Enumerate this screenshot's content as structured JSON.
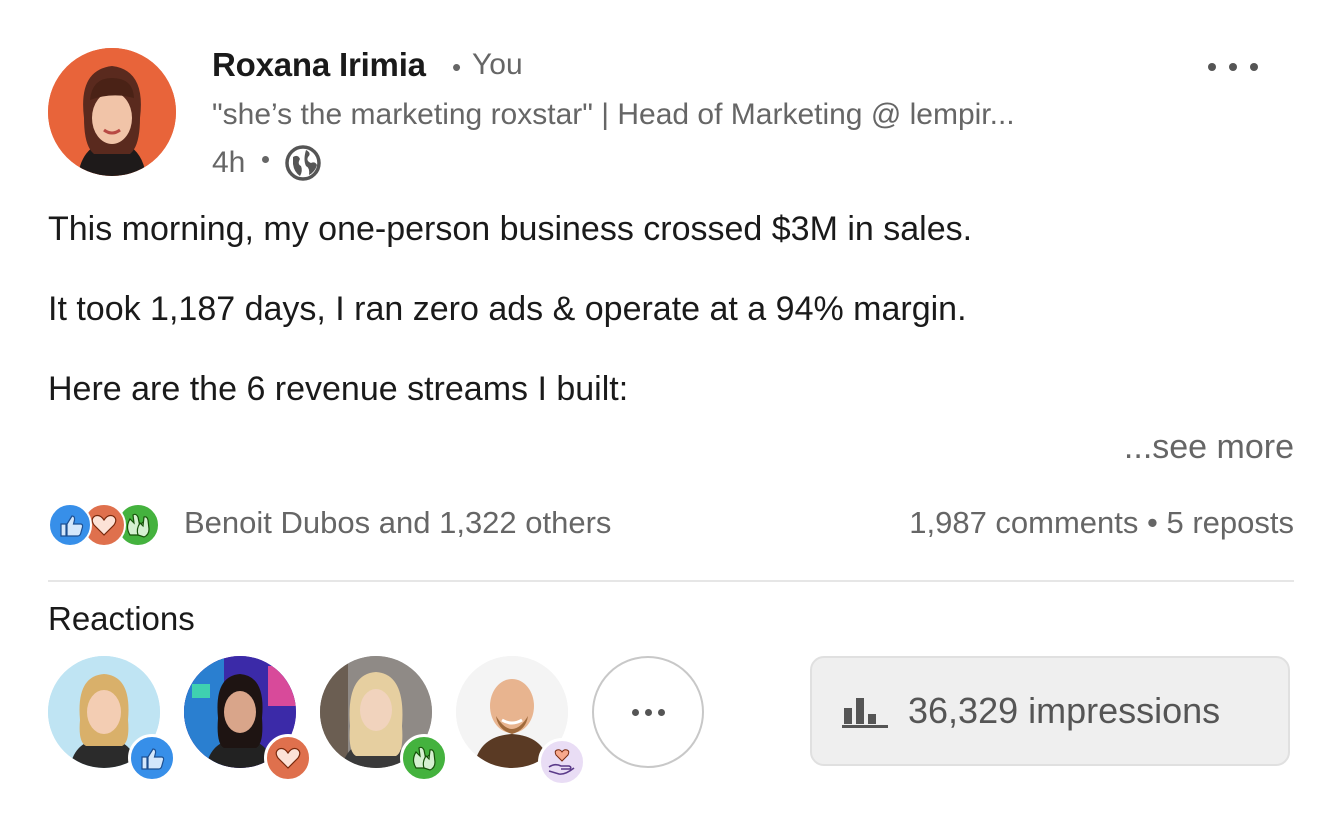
{
  "post": {
    "author_name": "Roxana Irimia",
    "separator": "•",
    "relation": "You",
    "headline": "\"she’s the marketing roxstar\" | Head of Marketing @ lempir...",
    "time": "4h",
    "visibility_icon": "globe-icon",
    "more_icon": "more-horizontal-icon",
    "body": [
      "This morning, my one-person business crossed $3M in sales.",
      "It took 1,187 days, I ran zero ads & operate at a 94% margin.",
      "Here are the 6 revenue streams I built:"
    ],
    "see_more": "...see more"
  },
  "social": {
    "reaction_icons": [
      "like-icon",
      "love-icon",
      "celebrate-icon"
    ],
    "reactor_name": "Benoit Dubos",
    "reactor_others": "and 1,322 others",
    "stats": "1,987 comments • 5 reposts"
  },
  "reactions": {
    "title": "Reactions",
    "people": [
      {
        "badge": "like-icon"
      },
      {
        "badge": "love-icon"
      },
      {
        "badge": "celebrate-icon"
      },
      {
        "badge": "support-icon"
      }
    ],
    "more_icon": "more-horizontal-icon"
  },
  "impressions": {
    "icon": "bar-chart-icon",
    "label": "36,329 impressions"
  },
  "colors": {
    "like": "#378fe9",
    "love": "#df704d",
    "celebrate": "#44b23e",
    "support": "#c4a7e0",
    "author_avatar_bg": "#e8643a"
  }
}
